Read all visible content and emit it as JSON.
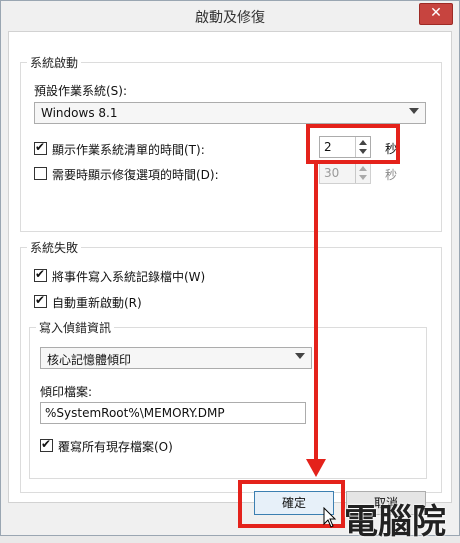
{
  "window": {
    "title": "啟動及修復",
    "close": "✕"
  },
  "startup": {
    "group_label": "系統啟動",
    "default_os_label": "預設作業系統(S):",
    "default_os_value": "Windows 8.1",
    "show_list": {
      "label": "顯示作業系統清單的時間(T):",
      "checked": true,
      "value": "2",
      "unit": "秒"
    },
    "show_recovery": {
      "label": "需要時顯示修復選項的時間(D):",
      "checked": false,
      "value": "30",
      "unit": "秒"
    }
  },
  "failure": {
    "group_label": "系統失敗",
    "write_log": {
      "label": "將事件寫入系統記錄檔中(W)",
      "checked": true
    },
    "auto_restart": {
      "label": "自動重新啟動(R)",
      "checked": true
    },
    "debug": {
      "group_label": "寫入偵錯資訊",
      "dump_type": "核心記憶體傾印",
      "dump_file_label": "傾印檔案:",
      "dump_file_value": "%SystemRoot%\\MEMORY.DMP",
      "overwrite": {
        "label": "覆寫所有現存檔案(O)",
        "checked": true
      }
    }
  },
  "buttons": {
    "ok": "確定",
    "cancel": "取消"
  },
  "watermark": "電腦王阿達",
  "accent_color": "#e4221b"
}
